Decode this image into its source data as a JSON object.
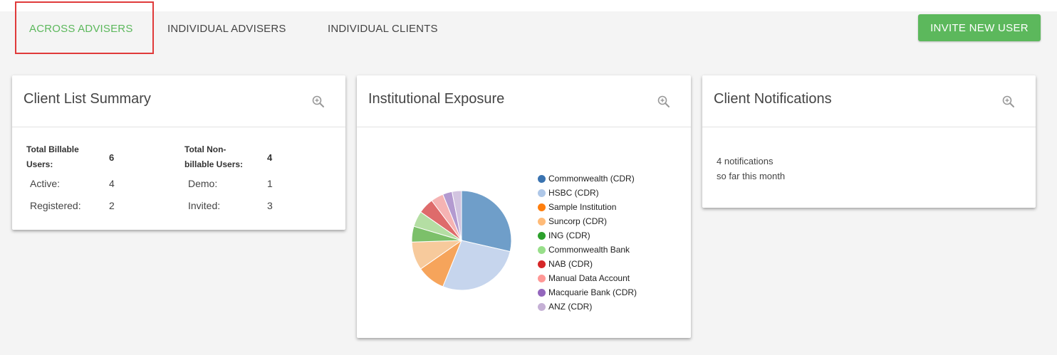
{
  "tabs": [
    {
      "label": "ACROSS ADVISERS",
      "active": true
    },
    {
      "label": "INDIVIDUAL ADVISERS",
      "active": false
    },
    {
      "label": "INDIVIDUAL CLIENTS",
      "active": false
    }
  ],
  "invite_button": "INVITE NEW USER",
  "accent_color": "#5cb85c",
  "highlight_color": "#e03a3a",
  "summary": {
    "title": "Client List Summary",
    "billable_label_1": "Total Billable",
    "billable_label_2": "Users:",
    "billable_value": "6",
    "nonbillable_label_1": "Total Non-",
    "nonbillable_label_2": "billable Users:",
    "nonbillable_value": "4",
    "active_label": "Active:",
    "active_value": "4",
    "registered_label": "Registered:",
    "registered_value": "2",
    "demo_label": "Demo:",
    "demo_value": "1",
    "invited_label": "Invited:",
    "invited_value": "3"
  },
  "exposure": {
    "title": "Institutional Exposure"
  },
  "chart_data": {
    "type": "pie",
    "title": "",
    "categories": [
      "Commonwealth (CDR)",
      "HSBC (CDR)",
      "Sample Institution",
      "Suncorp (CDR)",
      "ING (CDR)",
      "Commonwealth Bank",
      "NAB (CDR)",
      "Manual Data Account",
      "Macquarie Bank (CDR)",
      "ANZ (CDR)"
    ],
    "values": [
      28,
      27,
      9,
      9,
      5,
      5,
      5,
      4,
      3,
      3
    ],
    "colors": [
      "#6f9ec9",
      "#c6d5ed",
      "#f6a45b",
      "#f7ca9c",
      "#7cc06a",
      "#b4dea3",
      "#de6b6b",
      "#f5b3b3",
      "#b39ad0",
      "#d2c4e0"
    ],
    "legend_colors": [
      "#3a73b0",
      "#aec7e8",
      "#ff7f0e",
      "#ffbb78",
      "#2ca02c",
      "#98df8a",
      "#d62728",
      "#ff9896",
      "#9467bd",
      "#c5b0d5"
    ],
    "legend_position": "right"
  },
  "notifications": {
    "title": "Client Notifications",
    "line1": "4 notifications",
    "line2": "so far this month"
  },
  "icons": {
    "zoom": "zoom-in-icon"
  }
}
